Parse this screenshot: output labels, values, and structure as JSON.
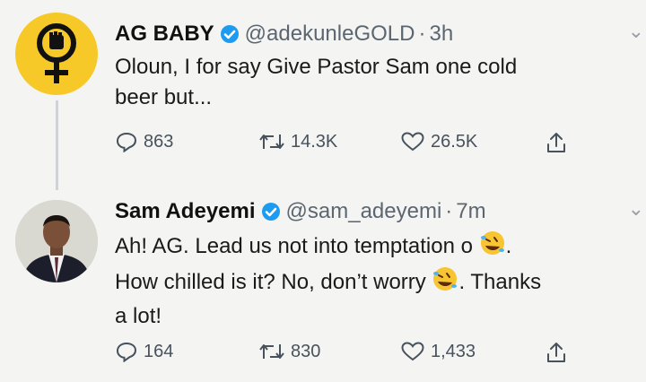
{
  "tweets": [
    {
      "name": "AG BABY",
      "handle": "@adekunleGOLD",
      "time": "3h",
      "text_lines": [
        "Oloun, I for say Give Pastor Sam one cold",
        "beer but..."
      ],
      "replies": "863",
      "retweets": "14.3K",
      "likes": "26.5K"
    },
    {
      "name": "Sam Adeyemi",
      "handle": "@sam_adeyemi",
      "time": "7m",
      "line1": "Ah! AG. Lead us not into temptation o",
      "line1_end": ".",
      "line2": "How chilled is it? No, don’t worry",
      "line2_end": ". Thanks",
      "line3": "a lot!",
      "replies": "164",
      "retweets": "830",
      "likes": "1,433"
    }
  ],
  "separator": "·",
  "colors": {
    "verified": "#1d9bf0",
    "avatar_yellow": "#f6c928",
    "icon_gray": "#48525c"
  },
  "icons": [
    "feminist-fist-icon",
    "verified-badge-icon",
    "reply-icon",
    "retweet-icon",
    "like-icon",
    "share-icon",
    "rofl-emoji-icon",
    "chevron-down-icon"
  ]
}
